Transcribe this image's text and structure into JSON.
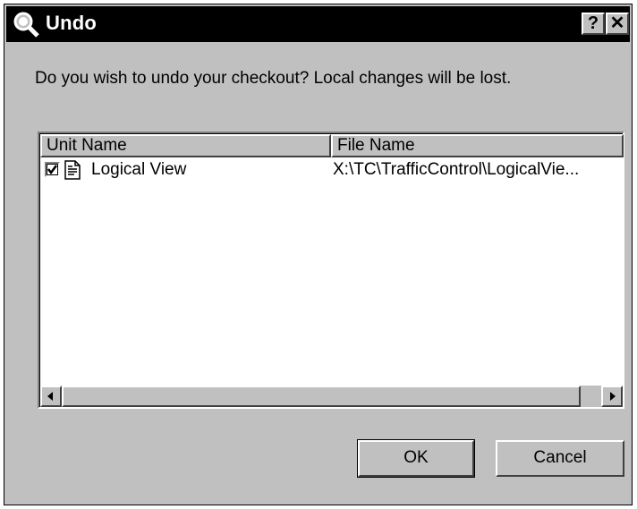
{
  "window": {
    "title": "Undo",
    "help_label": "?",
    "close_label": "✕"
  },
  "dialog": {
    "message": "Do you wish to undo your checkout?  Local changes will be lost."
  },
  "list": {
    "columns": [
      "Unit Name",
      "File Name"
    ],
    "rows": [
      {
        "checked": true,
        "unit": "Logical View",
        "file": "X:\\TC\\TrafficControl\\LogicalVie..."
      }
    ]
  },
  "buttons": {
    "ok": "OK",
    "cancel": "Cancel"
  }
}
